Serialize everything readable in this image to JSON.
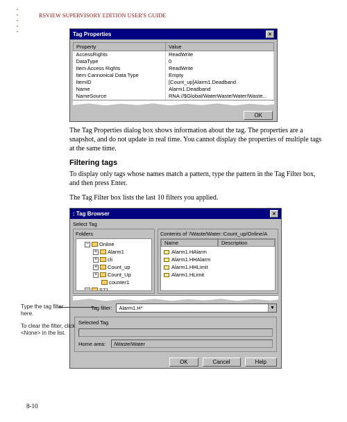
{
  "header": "RSVIEW SUPERVISORY EDITION USER'S GUIDE",
  "page_number": "8-10",
  "fig1": {
    "title": "Tag Properties",
    "col_property": "Property",
    "col_value": "Value",
    "rows": [
      {
        "p": "AccessRights",
        "v": "ReadWrite"
      },
      {
        "p": "DataType",
        "v": "0"
      },
      {
        "p": "Item Access Rights",
        "v": "ReadWrite"
      },
      {
        "p": "Item Cannonical Data Type",
        "v": "Empty"
      },
      {
        "p": "ItemID",
        "v": "[Count_up]Alarm1.Deadband"
      },
      {
        "p": "Name",
        "v": "Alarm1.Deadband"
      },
      {
        "p": "NameSource",
        "v": "RNA://$Global/WaterWaste/Water/Waste..."
      }
    ],
    "ok": "OK"
  },
  "para1": "The Tag Properties dialog box shows information about the tag. The properties are a snapshot, and do not update in real time. You cannot display the properties of multiple tags at the same time.",
  "heading": "Filtering tags",
  "para2": "To display only tags whose names match a pattern, type the pattern in the Tag Filter box, and then press Enter.",
  "para3": "The Tag Filter box lists the last 10 filters you applied.",
  "fig2": {
    "title": ": Tag Browser",
    "select_tag": "Select Tag",
    "folders": "Folders",
    "contents": "Contents of '/Waste/Water::Count_up/Online/A",
    "tree": [
      {
        "lvl": 1,
        "box": "-",
        "label": "Online"
      },
      {
        "lvl": 2,
        "box": "+",
        "label": "Alarm1"
      },
      {
        "lvl": 2,
        "box": "+",
        "label": "cli"
      },
      {
        "lvl": 2,
        "box": "+",
        "label": "Count_up"
      },
      {
        "lvl": 2,
        "box": "+",
        "label": "Count_Up"
      },
      {
        "lvl": 2,
        "box": "",
        "label": "counter1"
      },
      {
        "lvl": 1,
        "box": "-",
        "label": "S71"
      }
    ],
    "col_name": "Name",
    "col_desc": "Description",
    "list": [
      "Alarm1.HAlarm",
      "Alarm1.HHAlarm",
      "Alarm1.HHLimit",
      "Alarm1.HLimit"
    ],
    "tag_filter_label": "Tag filter:",
    "tag_filter_value": "Alarm1.H*",
    "selected_tag": "Selected Tag",
    "home_area": "Home area:",
    "home_area_value": "/Waste/Water",
    "ok": "OK",
    "cancel": "Cancel",
    "help": "Help"
  },
  "note1": "Type the tag filter here.",
  "note2": "To clear the filter, click <None> in the list."
}
